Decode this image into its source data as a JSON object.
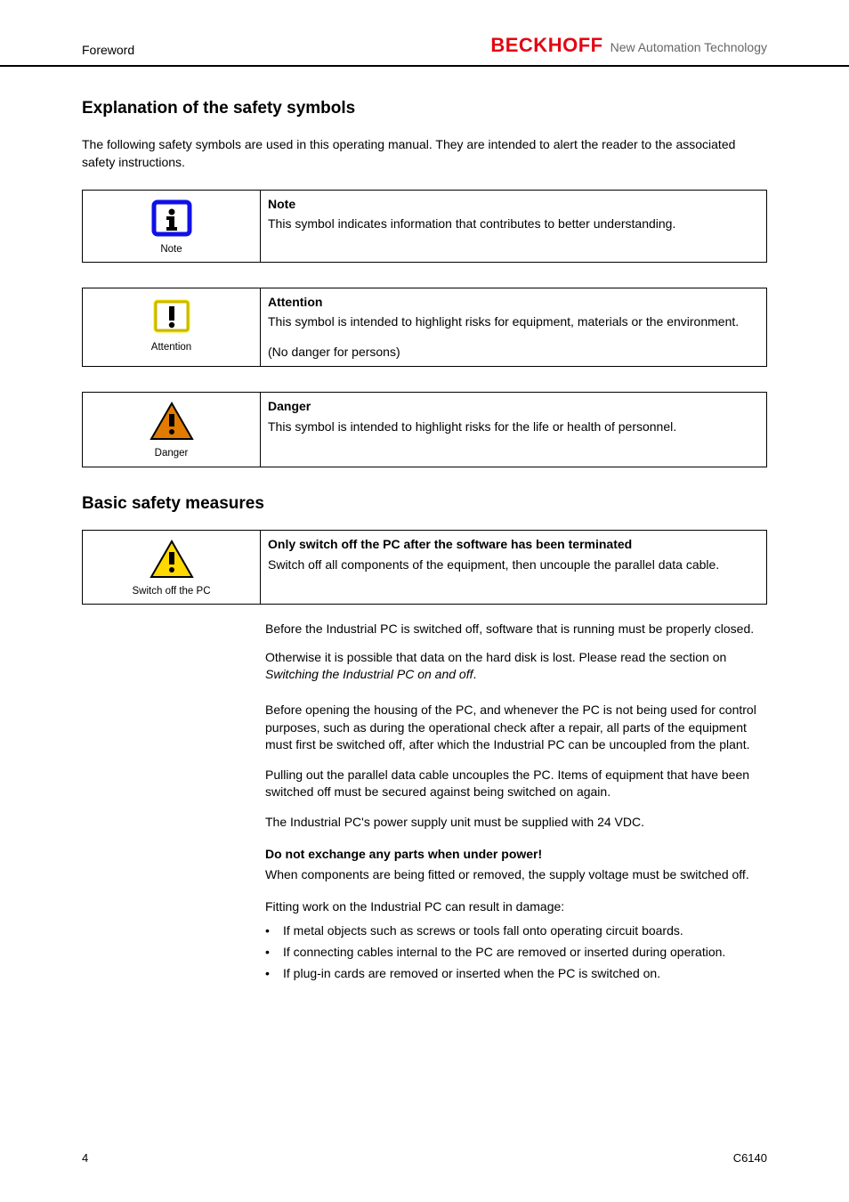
{
  "header": {
    "left": "Foreword",
    "logo_main": "BECKHOFF",
    "logo_sub": "New Automation Technology"
  },
  "heading": "Explanation of the safety symbols",
  "intro": "The following safety symbols are used in this operating manual. They are intended to alert the reader to the associated safety instructions.",
  "boxes": [
    {
      "caption": "Note",
      "title": "Note",
      "body": "This symbol indicates information that contributes to better understanding."
    },
    {
      "caption": "Attention",
      "title": "Attention",
      "body": "This symbol is intended to highlight risks for equipment, materials or the environment.",
      "extra": "(No danger for persons)"
    },
    {
      "caption": "Danger",
      "title": "Danger",
      "body": "This symbol is intended to highlight risks for the life or health of personnel."
    }
  ],
  "section": {
    "title": "Basic safety measures",
    "box": {
      "caption": "Switch off the PC",
      "title": "Only switch off the PC after the software has been terminated",
      "body": "Switch off all components of the equipment, then uncouple the parallel data cable."
    },
    "para1_a": "Before the Industrial PC is switched off, software that is running must be properly closed.",
    "para1_b": "Otherwise it is possible that data on the hard disk is lost. Please read the section on",
    "para1_link": "Switching the Industrial PC on and off",
    "para2": "Before opening the housing of the PC, and whenever the PC is not being used for control purposes, such as during the operational check after a repair, all parts of the equipment must first be switched off, after which the Industrial PC can be uncoupled from the plant.",
    "para3": "Pulling out the parallel data cable uncouples the PC. Items of equipment that have been switched off must be secured against being switched on again.",
    "para4": "The Industrial PC's power supply unit must be supplied with 24 VDC.",
    "warn_box": {
      "line1": "Do not exchange any parts when under power!",
      "line2": "When components are being fitted or removed, the supply voltage must be switched off."
    },
    "para5": "Fitting work on the Industrial PC can result in damage:",
    "bullets": [
      "If metal objects such as screws or tools fall onto operating circuit boards.",
      "If connecting cables internal to the PC are removed or inserted during operation.",
      "If plug-in cards are removed or inserted when the PC is switched on."
    ]
  },
  "footer": {
    "page": "4",
    "doc": "C6140"
  }
}
